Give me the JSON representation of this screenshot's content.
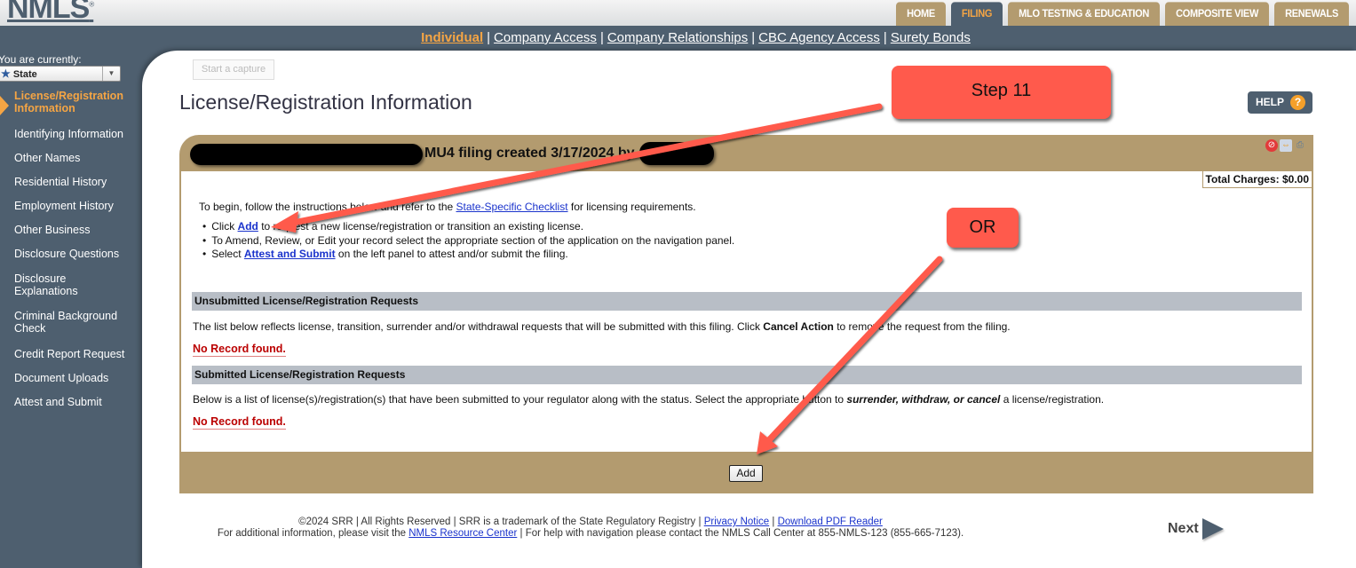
{
  "header": {
    "logo": "NMLS",
    "logo_mark": "®",
    "tabs": [
      {
        "label": "HOME",
        "active": false
      },
      {
        "label": "FILING",
        "active": true
      },
      {
        "label": "MLO TESTING & EDUCATION",
        "active": false
      },
      {
        "label": "COMPOSITE VIEW",
        "active": false
      },
      {
        "label": "RENEWALS",
        "active": false
      }
    ]
  },
  "subnav": {
    "links": [
      "Individual",
      "Company Access",
      "Company Relationships",
      "CBC Agency Access",
      "Surety Bonds"
    ],
    "active": "Individual"
  },
  "sidebar": {
    "current_label": "You are currently:",
    "current_value": "State",
    "items": [
      {
        "label": "License/Registration Information",
        "active": true
      },
      {
        "label": "Identifying Information"
      },
      {
        "label": "Other Names"
      },
      {
        "label": "Residential History"
      },
      {
        "label": "Employment History"
      },
      {
        "label": "Other Business"
      },
      {
        "label": "Disclosure Questions"
      },
      {
        "label": "Disclosure Explanations"
      },
      {
        "label": "Criminal Background Check"
      },
      {
        "label": "Credit Report Request"
      },
      {
        "label": "Document Uploads"
      },
      {
        "label": "Attest and Submit"
      }
    ]
  },
  "content": {
    "capture_button": "Start a capture",
    "page_title": "License/Registration Information",
    "help_label": "HELP",
    "help_icon": "?",
    "filing_title": "MU4 filing created 3/17/2024 by",
    "tool_icons": [
      "no-flash-icon",
      "compare-icon",
      "print-icon"
    ],
    "total_charges": "Total Charges: $0.00",
    "intro": {
      "before": "To begin, follow the instructions below and refer to the ",
      "link": "State-Specific Checklist",
      "after": " for licensing requirements."
    },
    "bullets": [
      {
        "before": "Click ",
        "link": "Add",
        "after": " to request a new license/registration or transition an existing license."
      },
      {
        "before": "To Amend, Review, or Edit your record select the appropriate section of the application on the navigation panel.",
        "link": "",
        "after": ""
      },
      {
        "before": "Select ",
        "link": "Attest and Submit",
        "after": " on the left panel to attest and/or submit the filing."
      }
    ],
    "unsubmitted": {
      "header": "Unsubmitted License/Registration Requests",
      "text_before": "The list below reflects license, transition, surrender and/or withdrawal requests that will be submitted with this filing. Click ",
      "text_bold": "Cancel Action",
      "text_after": " to remove the request from the filing.",
      "empty": "No Record found."
    },
    "submitted": {
      "header": "Submitted License/Registration Requests",
      "text_before": "Below is a list of license(s)/registration(s) that have been submitted to your regulator along with the status. Select the appropriate button to ",
      "text_bold": "surrender, withdraw, or cancel",
      "text_after": " a license/registration.",
      "empty": "No Record found."
    },
    "add_button": "Add"
  },
  "footer": {
    "line1_text": "©2024 SRR | All Rights Reserved | SRR is a trademark of the State Regulatory Registry | ",
    "privacy_link": "Privacy Notice",
    "sep": " | ",
    "pdf_link": "Download PDF Reader",
    "line2_before": "For additional information, please visit the ",
    "resource_link": "NMLS Resource Center",
    "line2_after": " | For help with navigation please contact the NMLS Call Center at 855-NMLS-123 (855-665-7123).",
    "next_label": "Next"
  },
  "annotations": {
    "step_label": "Step 11",
    "or_label": "OR",
    "color": "#ff5a4c"
  }
}
